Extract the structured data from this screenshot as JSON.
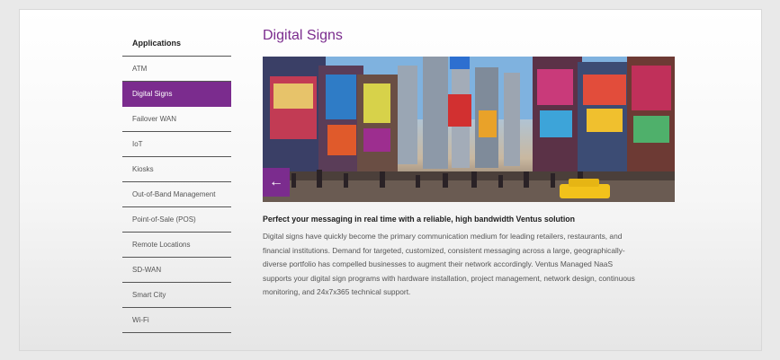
{
  "sidebar": {
    "heading": "Applications",
    "items": [
      {
        "label": "ATM"
      },
      {
        "label": "Digital Signs",
        "active": true
      },
      {
        "label": "Failover WAN"
      },
      {
        "label": "IoT"
      },
      {
        "label": "Kiosks"
      },
      {
        "label": "Out-of-Band Management"
      },
      {
        "label": "Point-of-Sale (POS)"
      },
      {
        "label": "Remote Locations"
      },
      {
        "label": "SD-WAN"
      },
      {
        "label": "Smart City"
      },
      {
        "label": "Wi-Fi"
      }
    ]
  },
  "main": {
    "title": "Digital Signs",
    "carousel": {
      "prev_icon": "arrow-left-icon",
      "next_icon": "arrow-right-icon",
      "prev_glyph": "←",
      "next_glyph": "→"
    },
    "subheading": "Perfect your messaging in real time with a reliable, high bandwidth Ventus solution",
    "body": "Digital signs have quickly become the primary communication medium for leading retailers, restaurants, and financial institutions. Demand for targeted, customized, consistent messaging across a large, geographically-diverse portfolio has compelled businesses to augment their network accordingly. Ventus Managed NaaS supports your digital sign programs with hardware installation, project management, network design, continuous monitoring, and 24x7x365 technical support."
  },
  "colors": {
    "accent": "#7b2c8e",
    "background": "#e9e9e9"
  }
}
